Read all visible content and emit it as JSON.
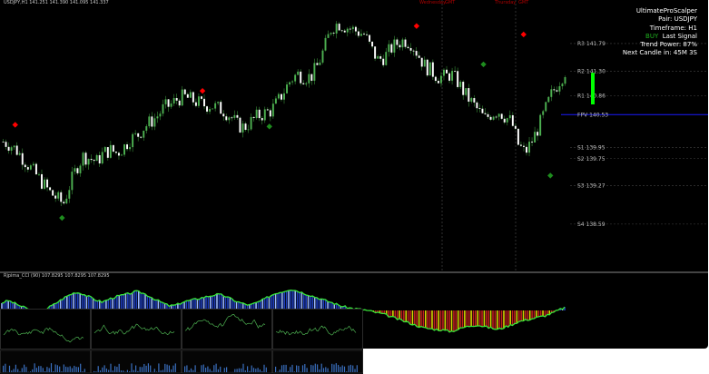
{
  "window": {
    "symbol_header": "USDJPY,H1   141.251 141.390 141.095 141.337",
    "indicator_header": "Rjpima_CCI (90) 107.8295 107.8295 107.8295",
    "day_labels": [
      "Wednesday",
      "GMT",
      "Thursday",
      "GMT"
    ]
  },
  "info_panel": {
    "title": "UltimateProScalper",
    "pair": "Pair: USDJPY",
    "timeframe": "Timeframe: H1",
    "signal_prefix": "BUY",
    "signal_suffix": "Last Signal",
    "trend_power": "Trend Power: 87%",
    "next_candle": "Next Candle in: 45M 3S"
  },
  "colors": {
    "bull": "#4caf50",
    "bear": "#ffffff",
    "wick": "#3a8f3a",
    "sell_signal": "#ff0000",
    "buy_signal": "#1e8c1e",
    "pivot_line": "#1a1aff",
    "grid": "#444444",
    "hist_pos": "#1f3fbf",
    "hist_neg": "#bf1f1f",
    "hist_outline": "#39e639",
    "power_bar": "#00ff00"
  },
  "chart_data": [
    {
      "type": "candlestick",
      "title": "USDJPY,H1",
      "ylim": [
        137.8,
        142.4
      ],
      "levels": [
        {
          "name": "R3",
          "value": 141.79
        },
        {
          "name": "R2",
          "value": 141.3
        },
        {
          "name": "R1",
          "value": 140.86
        },
        {
          "name": "FPV",
          "value": 140.53
        },
        {
          "name": "S1",
          "value": 139.95
        },
        {
          "name": "S2",
          "value": 139.75
        },
        {
          "name": "S3",
          "value": 139.27
        },
        {
          "name": "S4",
          "value": 138.59
        }
      ],
      "level_labels": [
        "R3  141.79",
        "R2  141.30",
        "R1  140.86",
        "FPV  140.53",
        "S1  139.95",
        "S2  139.75",
        "S3  139.27",
        "S4  138.59"
      ],
      "close_path": [
        140.05,
        140.0,
        139.9,
        139.75,
        139.6,
        139.45,
        139.3,
        139.15,
        139.05,
        138.95,
        139.3,
        139.6,
        139.8,
        139.75,
        139.7,
        139.85,
        139.9,
        139.85,
        139.95,
        140.1,
        140.15,
        140.3,
        140.4,
        140.5,
        140.65,
        140.7,
        140.8,
        140.85,
        140.8,
        140.75,
        140.7,
        140.7,
        140.65,
        140.6,
        140.5,
        140.35,
        140.3,
        140.4,
        140.5,
        140.55,
        140.6,
        140.75,
        140.95,
        141.15,
        141.25,
        141.2,
        141.2,
        141.4,
        141.7,
        142.05,
        142.15,
        142.1,
        142.05,
        142.0,
        141.95,
        141.7,
        141.5,
        141.55,
        141.7,
        141.8,
        141.85,
        141.8,
        141.6,
        141.4,
        141.3,
        141.2,
        141.2,
        141.25,
        141.1,
        140.9,
        140.75,
        140.6,
        140.45,
        140.55,
        140.6,
        140.5,
        140.4,
        140.0,
        139.85,
        140.05,
        140.3,
        140.6,
        140.9,
        141.1,
        141.3
      ],
      "signals": [
        {
          "type": "sell",
          "index": 2,
          "price": 140.35
        },
        {
          "type": "buy",
          "index": 9,
          "price": 138.7
        },
        {
          "type": "sell",
          "index": 30,
          "price": 140.95
        },
        {
          "type": "buy",
          "index": 40,
          "price": 140.32
        },
        {
          "type": "sell",
          "index": 62,
          "price": 142.1
        },
        {
          "type": "buy",
          "index": 72,
          "price": 141.42
        },
        {
          "type": "sell",
          "index": 78,
          "price": 141.95
        },
        {
          "type": "buy",
          "index": 82,
          "price": 139.45
        }
      ],
      "power_bar": {
        "value": 87,
        "unit": "%"
      }
    },
    {
      "type": "histogram",
      "title": "Rjpima_CCI (90)",
      "values": [
        20,
        26,
        18,
        10,
        4,
        -6,
        -4,
        8,
        18,
        30,
        40,
        48,
        44,
        36,
        28,
        22,
        30,
        36,
        40,
        44,
        50,
        46,
        38,
        28,
        20,
        12,
        14,
        22,
        26,
        30,
        34,
        38,
        42,
        40,
        32,
        24,
        18,
        14,
        20,
        28,
        38,
        46,
        50,
        56,
        52,
        46,
        40,
        34,
        28,
        22,
        16,
        10,
        6,
        4,
        2,
        -2,
        -6,
        -10,
        -16,
        -22,
        -28,
        -34,
        -40,
        -46,
        -48,
        -50,
        -52,
        -55,
        -50,
        -44,
        -40,
        -38,
        -42,
        -46,
        -50,
        -44,
        -38,
        -30,
        -26,
        -22,
        -18,
        -14,
        -8,
        0,
        8
      ]
    }
  ]
}
